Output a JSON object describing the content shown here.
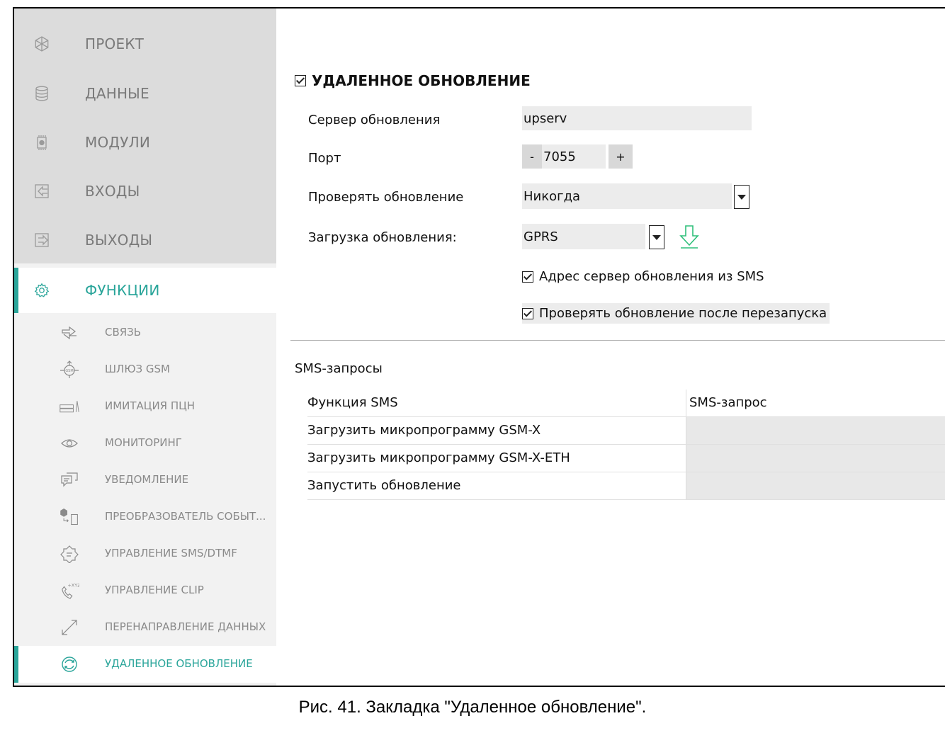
{
  "sidebar": {
    "main_items": [
      {
        "label": "ПРОЕКТ",
        "icon": "project-icon"
      },
      {
        "label": "ДАННЫЕ",
        "icon": "database-icon"
      },
      {
        "label": "МОДУЛИ",
        "icon": "module-chip-icon"
      },
      {
        "label": "ВХОДЫ",
        "icon": "input-arrow-icon"
      },
      {
        "label": "ВЫХОДЫ",
        "icon": "output-arrow-icon"
      },
      {
        "label": "ФУНКЦИИ",
        "icon": "gear-icon",
        "active": true
      }
    ],
    "sub_items": [
      {
        "label": "СВЯЗЬ",
        "icon": "communication-icon"
      },
      {
        "label": "ШЛЮЗ GSM",
        "icon": "gsm-gateway-icon"
      },
      {
        "label": "ИМИТАЦИЯ ПЦН",
        "icon": "receiver-icon"
      },
      {
        "label": "МОНИТОРИНГ",
        "icon": "eye-icon"
      },
      {
        "label": "УВЕДОМЛЕНИЕ",
        "icon": "notification-icon"
      },
      {
        "label": "ПРЕОБРАЗОВАТЕЛЬ СОБЫТ...",
        "icon": "event-converter-icon"
      },
      {
        "label": "УПРАВЛЕНИЕ SMS/DTMF",
        "icon": "sms-control-icon"
      },
      {
        "label": "УПРАВЛЕНИЕ CLIP",
        "icon": "clip-phone-icon"
      },
      {
        "label": "ПЕРЕНАПРАВЛЕНИЕ ДАННЫХ",
        "icon": "redirect-arrows-icon"
      },
      {
        "label": "УДАЛЕННОЕ ОБНОВЛЕНИЕ",
        "icon": "refresh-icon",
        "active": true
      }
    ]
  },
  "remote_update": {
    "title": "УДАЛЕННОЕ ОБНОВЛЕНИЕ",
    "enabled": true,
    "server_label": "Сервер обновления",
    "server_value": "upserv",
    "port_label": "Порт",
    "port_value": "7055",
    "port_minus": "-",
    "port_plus": "+",
    "check_label": "Проверять обновление",
    "check_value": "Никогда",
    "download_label": "Загрузка обновления:",
    "download_value": "GPRS",
    "sms_address_label": "Адрес сервер обновления из SMS",
    "sms_address_checked": true,
    "check_restart_label": "Проверять обновление после перезапуска",
    "check_restart_checked": true
  },
  "sms_requests": {
    "title": "SMS-запросы",
    "headers": [
      "Функция SMS",
      "SMS-запрос"
    ],
    "rows": [
      {
        "function": "Загрузить микропрограмму GSM-X",
        "request": ""
      },
      {
        "function": "Загрузить микропрограмму GSM-X-ETH",
        "request": ""
      },
      {
        "function": "Запустить обновление",
        "request": ""
      }
    ]
  },
  "caption": "Рис. 41. Закладка \"Удаленное обновление\".",
  "colors": {
    "accent": "#2aa59a",
    "sidebar_main_bg": "#dcdcdc",
    "sidebar_sub_bg": "#f2f2f2",
    "field_bg": "#ececec"
  }
}
